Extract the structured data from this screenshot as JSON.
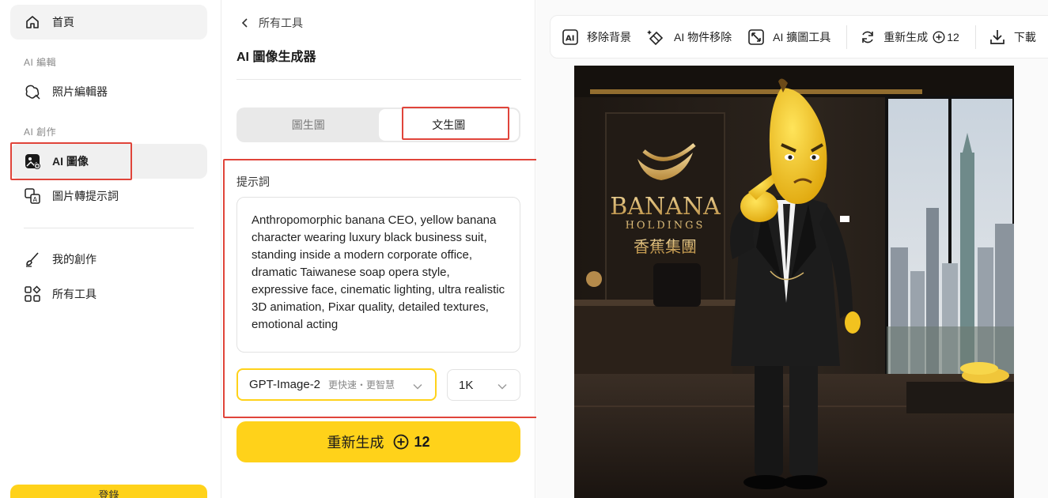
{
  "sidebar": {
    "home_label": "首頁",
    "section_edit": "AI 編輯",
    "photo_editor_label": "照片編輯器",
    "section_create": "AI 創作",
    "ai_image_label": "AI 圖像",
    "image_to_prompt_label": "圖片轉提示詞",
    "my_creations_label": "我的創作",
    "all_tools_label": "所有工具",
    "login_label": "登錄"
  },
  "panel": {
    "back_label": "所有工具",
    "title": "AI 圖像生成器",
    "tabs": [
      {
        "label": "圖生圖",
        "selected": false
      },
      {
        "label": "文生圖",
        "selected": true
      }
    ],
    "prompt_label": "提示詞",
    "prompt_text": "Anthropomorphic banana CEO, yellow banana character wearing luxury black business suit, standing inside a modern corporate office, dramatic Taiwanese soap opera style, expressive face, cinematic lighting, ultra realistic 3D animation, Pixar quality, detailed textures, emotional acting",
    "model": {
      "name": "GPT-Image-2",
      "subtitle": "更快速・更智慧"
    },
    "resolution": "1K",
    "generate_label": "重新生成",
    "generate_cost": "12"
  },
  "toolbar": {
    "remove_bg": "移除背景",
    "remove_object": "AI 物件移除",
    "expand": "AI 擴圖工具",
    "regenerate": "重新生成",
    "regenerate_cost": "12",
    "download": "下載"
  },
  "image": {
    "sign_line1": "BANANA",
    "sign_line2": "HOLDINGS",
    "sign_line3": "香蕉集團"
  },
  "colors": {
    "accent": "#ffd21a",
    "highlight_box": "#e0443a"
  }
}
